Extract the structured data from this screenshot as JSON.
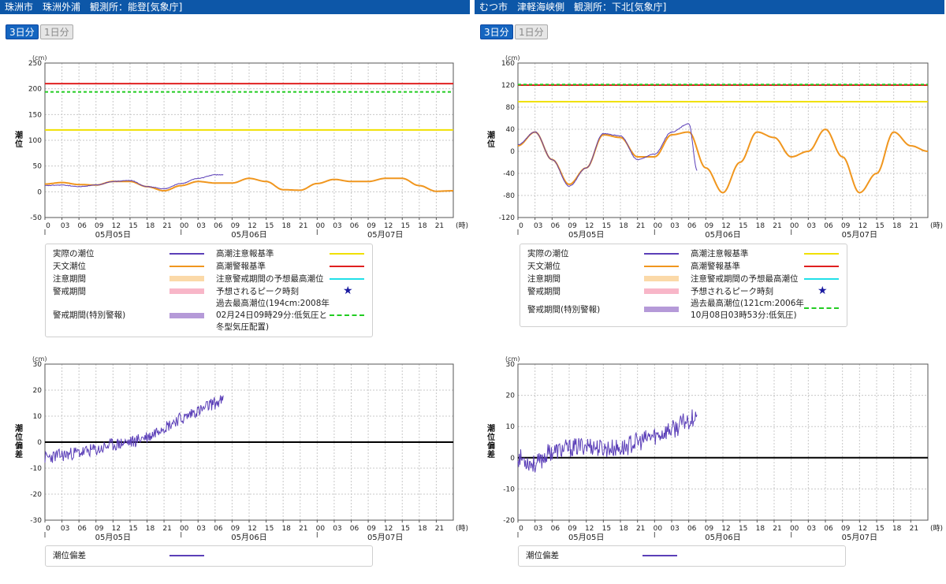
{
  "colors": {
    "header_bg": "#0d57a8",
    "observed": "#5b3fb8",
    "astronomical": "#f0961e",
    "caution_level": "#f0e000",
    "warning_level": "#e02020",
    "predicted_max": "#20e0e8",
    "caution_period": "#fbd9a8",
    "warning_period": "#f8b6c8",
    "special_warning_period": "#b59ad8",
    "peak_star": "#1a1aa0",
    "record_high": "#22cc22",
    "deviation": "#5b3fb8"
  },
  "common": {
    "btn_3day": "3日分",
    "btn_1day": "1日分",
    "unit": "(cm)",
    "hour_label": "(時)",
    "tide_ylabel": [
      "潮",
      "位"
    ],
    "dev_ylabel": [
      "潮",
      "位",
      "偏",
      "差"
    ],
    "hour_ticks": [
      "0",
      "03",
      "06",
      "09",
      "12",
      "15",
      "18",
      "21",
      "00",
      "03",
      "06",
      "09",
      "12",
      "15",
      "18",
      "21",
      "00",
      "03",
      "06",
      "09",
      "12",
      "15",
      "18",
      "21"
    ],
    "date_labels": [
      "05月05日",
      "05月06日",
      "05月07日"
    ],
    "legend": {
      "observed": "実際の潮位",
      "astronomical": "天文潮位",
      "caution_period": "注意期間",
      "warning_period": "警戒期間",
      "special_warning_period": "警戒期間(特別警報)",
      "caution_level": "高潮注意報基準",
      "warning_level": "高潮警報基準",
      "predicted_max": "注意警戒期間の予想最高潮位",
      "peak_time": "予想されるピーク時刻",
      "deviation": "潮位偏差"
    }
  },
  "stations": [
    {
      "header": "珠洲市　珠洲外浦　観測所：能登[気象庁]",
      "record_high_lines": [
        "過去最高潮位(194cm:2008年",
        "02月24日09時29分:低気圧と",
        "冬型気圧配置)"
      ],
      "chart_data": [
        {
          "type": "line",
          "title": "",
          "xlabel": "(時)",
          "ylabel": "潮位",
          "unit": "(cm)",
          "xlim_hours": [
            0,
            72
          ],
          "ylim": [
            -50,
            250
          ],
          "yticks": [
            -50,
            0,
            50,
            100,
            150,
            200,
            250
          ],
          "grid": true,
          "reference_lines": [
            {
              "name": "高潮警報基準",
              "value": 210
            },
            {
              "name": "過去最高潮位",
              "value": 194
            },
            {
              "name": "高潮注意報基準",
              "value": 120
            }
          ],
          "series": [
            {
              "name": "天文潮位",
              "x": [
                0,
                3,
                6,
                9,
                12,
                15,
                18,
                21,
                24,
                27,
                30,
                33,
                36,
                39,
                42,
                45,
                48,
                51,
                54,
                57,
                60,
                63,
                66,
                69,
                72
              ],
              "values": [
                15,
                18,
                14,
                13,
                20,
                20,
                10,
                2,
                12,
                20,
                17,
                17,
                26,
                20,
                4,
                3,
                16,
                24,
                20,
                20,
                26,
                26,
                12,
                1,
                2
              ]
            },
            {
              "name": "実際の潮位",
              "x": [
                0,
                3,
                6,
                9,
                12,
                15,
                18,
                21,
                24,
                27,
                30,
                31.5
              ],
              "values": [
                12,
                13,
                10,
                13,
                20,
                22,
                10,
                6,
                16,
                26,
                33,
                33
              ]
            }
          ]
        },
        {
          "type": "line",
          "title": "",
          "xlabel": "(時)",
          "ylabel": "潮位偏差",
          "unit": "(cm)",
          "xlim_hours": [
            0,
            72
          ],
          "ylim": [
            -30,
            30
          ],
          "yticks": [
            -30,
            -20,
            -10,
            0,
            10,
            20,
            30
          ],
          "grid": true,
          "reference_lines": [
            {
              "name": "0",
              "value": 0
            }
          ],
          "series": [
            {
              "name": "潮位偏差",
              "x": [
                0,
                3,
                6,
                9,
                12,
                15,
                18,
                21,
                24,
                27,
                30,
                31.5
              ],
              "values": [
                -6,
                -5,
                -4,
                -3,
                -1,
                0,
                2,
                6,
                9,
                12,
                15,
                16
              ]
            }
          ]
        }
      ]
    },
    {
      "header": "むつ市　津軽海峡側　観測所：下北[気象庁]",
      "record_high_lines": [
        "過去最高潮位(121cm:2006年",
        "10月08日03時53分:低気圧)"
      ],
      "chart_data": [
        {
          "type": "line",
          "title": "",
          "xlabel": "(時)",
          "ylabel": "潮位",
          "unit": "(cm)",
          "xlim_hours": [
            0,
            72
          ],
          "ylim": [
            -120,
            160
          ],
          "yticks": [
            -120,
            -80,
            -40,
            0,
            40,
            80,
            120,
            160
          ],
          "grid": true,
          "reference_lines": [
            {
              "name": "高潮警報基準",
              "value": 120
            },
            {
              "name": "過去最高潮位",
              "value": 121
            },
            {
              "name": "高潮注意報基準",
              "value": 90
            }
          ],
          "series": [
            {
              "name": "天文潮位",
              "x": [
                0,
                3,
                6,
                9,
                12,
                15,
                18,
                21,
                24,
                27,
                30,
                33,
                36,
                39,
                42,
                45,
                48,
                51,
                54,
                57,
                60,
                63,
                66,
                69,
                72
              ],
              "values": [
                10,
                35,
                -15,
                -60,
                -30,
                30,
                25,
                -10,
                -10,
                30,
                35,
                -30,
                -75,
                -20,
                35,
                25,
                -10,
                0,
                40,
                -10,
                -75,
                -40,
                35,
                10,
                0
              ]
            },
            {
              "name": "実際の潮位",
              "x": [
                0,
                3,
                6,
                9,
                12,
                15,
                18,
                21,
                24,
                27,
                30,
                31.5
              ],
              "values": [
                12,
                35,
                -15,
                -63,
                -30,
                32,
                28,
                -15,
                -5,
                35,
                50,
                -35
              ]
            }
          ]
        },
        {
          "type": "line",
          "title": "",
          "xlabel": "(時)",
          "ylabel": "潮位偏差",
          "unit": "(cm)",
          "xlim_hours": [
            0,
            72
          ],
          "ylim": [
            -20,
            30
          ],
          "yticks": [
            -20,
            -10,
            0,
            10,
            20,
            30
          ],
          "grid": true,
          "reference_lines": [
            {
              "name": "0",
              "value": 0
            }
          ],
          "series": [
            {
              "name": "潮位偏差",
              "x": [
                0,
                3,
                6,
                9,
                12,
                15,
                18,
                21,
                24,
                27,
                30,
                31.5
              ],
              "values": [
                0,
                -2,
                2,
                3,
                4,
                3,
                3,
                5,
                7,
                9,
                12,
                14
              ]
            }
          ]
        }
      ]
    }
  ]
}
